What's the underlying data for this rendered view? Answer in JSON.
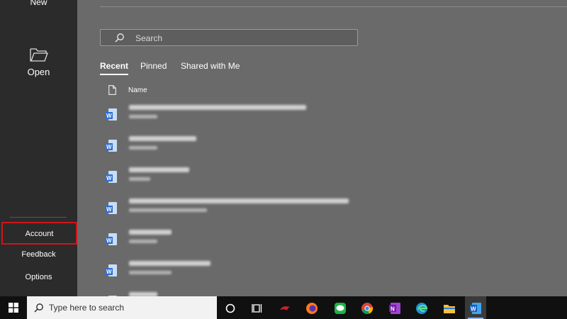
{
  "sidebar": {
    "new_label": "New",
    "open_label": "Open",
    "account_label": "Account",
    "feedback_label": "Feedback",
    "options_label": "Options"
  },
  "main": {
    "search_placeholder": "Search",
    "tabs": [
      {
        "label": "Recent",
        "active": true
      },
      {
        "label": "Pinned",
        "active": false
      },
      {
        "label": "Shared with Me",
        "active": false
      }
    ],
    "column_name": "Name"
  },
  "taskbar": {
    "search_placeholder": "Type here to search",
    "apps": [
      "cortana-icon",
      "task-view-icon",
      "app-red-icon",
      "firefox-icon",
      "line-icon",
      "chrome-icon",
      "onenote-icon",
      "edge-icon",
      "file-explorer-icon",
      "word-icon"
    ]
  },
  "colors": {
    "sidebar_bg": "#2b2b2b",
    "main_bg": "#6a6a6a",
    "highlight_border": "#d1141c",
    "taskbar_bg": "#101010"
  }
}
